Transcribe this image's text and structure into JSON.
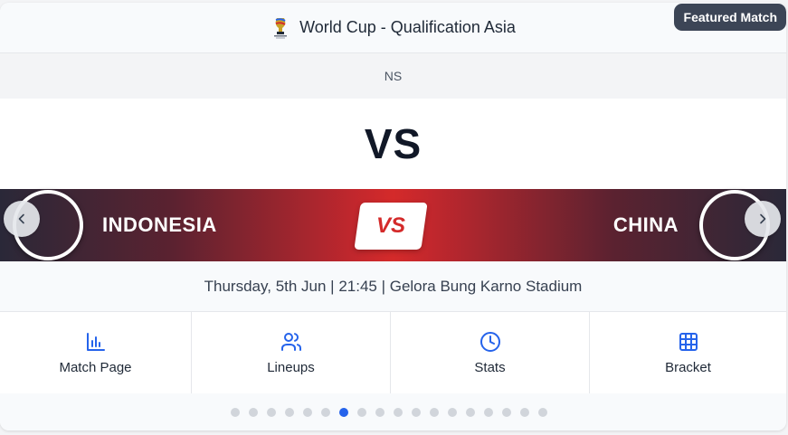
{
  "header": {
    "competition": "World Cup - Qualification Asia",
    "league_logo_icon": "world-cup-trophy-icon",
    "featured_badge": "Featured Match"
  },
  "status": "NS",
  "vs_heading": "VS",
  "banner": {
    "home_team": "INDONESIA",
    "away_team": "CHINA",
    "vs_badge": "VS",
    "prev_icon": "chevron-left-icon",
    "next_icon": "chevron-right-icon"
  },
  "match_info": "Thursday, 5th Jun | 21:45 | Gelora Bung Karno Stadium",
  "actions": [
    {
      "label": "Match Page",
      "icon": "bar-chart-icon"
    },
    {
      "label": "Lineups",
      "icon": "users-icon"
    },
    {
      "label": "Stats",
      "icon": "clock-icon"
    },
    {
      "label": "Bracket",
      "icon": "grid-icon"
    }
  ],
  "pagination": {
    "total": 18,
    "active_index": 6
  },
  "colors": {
    "accent": "#2563eb",
    "banner_red": "#d42a2a",
    "banner_dark": "#2a2838",
    "badge_bg": "#3c4556"
  }
}
